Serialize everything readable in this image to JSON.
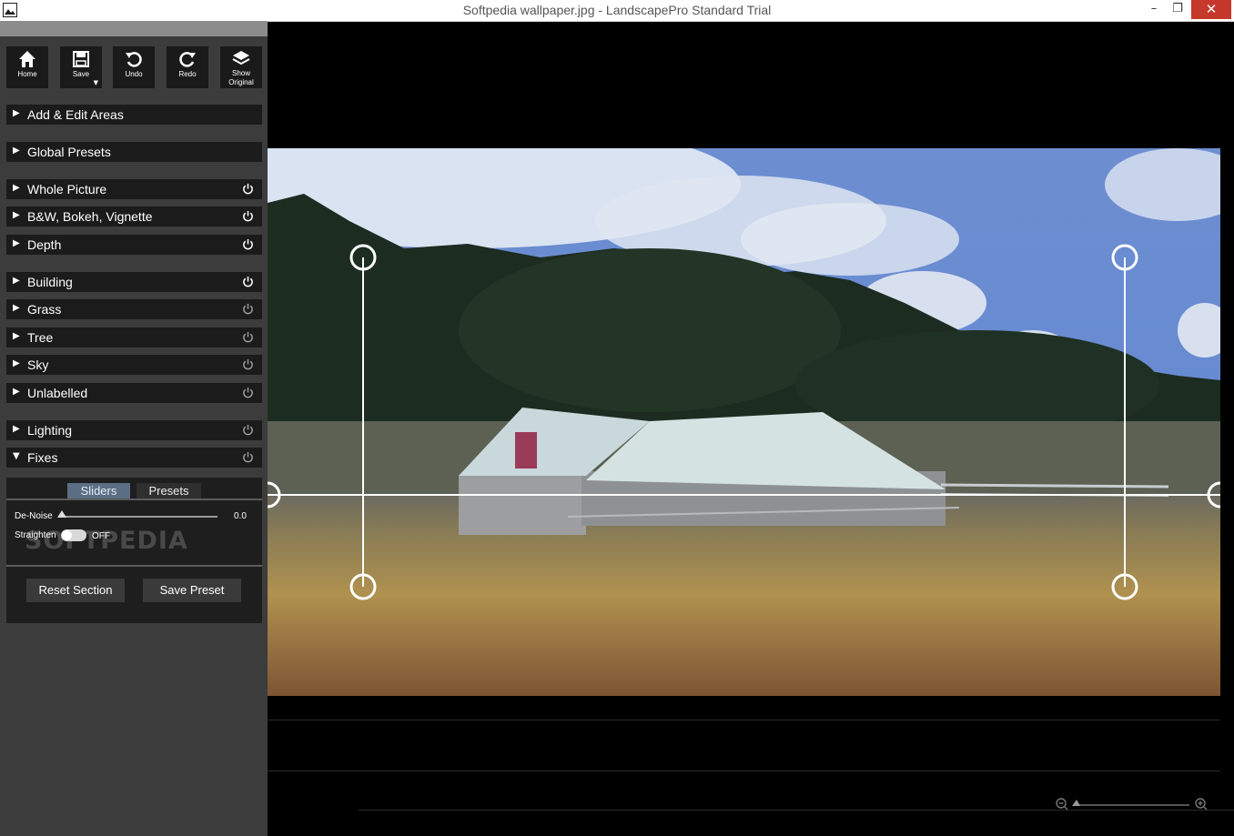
{
  "window": {
    "title": "Softpedia wallpaper.jpg - LandscapePro Standard Trial",
    "minimize": "–",
    "maximize": "❐",
    "close": "✕"
  },
  "toolbar": {
    "home": "Home",
    "save": "Save",
    "undo": "Undo",
    "redo": "Redo",
    "show_original": [
      "Show",
      "Original"
    ]
  },
  "sections": {
    "add_edit_areas": "Add & Edit Areas",
    "global_presets": "Global Presets",
    "whole_picture": "Whole Picture",
    "bw_bokeh_vignette": "B&W, Bokeh, Vignette",
    "depth": "Depth",
    "building": "Building",
    "grass": "Grass",
    "tree": "Tree",
    "sky": "Sky",
    "unlabelled": "Unlabelled",
    "lighting": "Lighting",
    "fixes": "Fixes"
  },
  "fixes": {
    "tab_sliders": "Sliders",
    "tab_presets": "Presets",
    "denoise_label": "De-Noise",
    "denoise_value": "0.0",
    "straighten_label": "Straighten",
    "straighten_state": "OFF",
    "reset_section": "Reset Section",
    "save_preset": "Save Preset"
  },
  "watermark": "SOFTPEDIA"
}
